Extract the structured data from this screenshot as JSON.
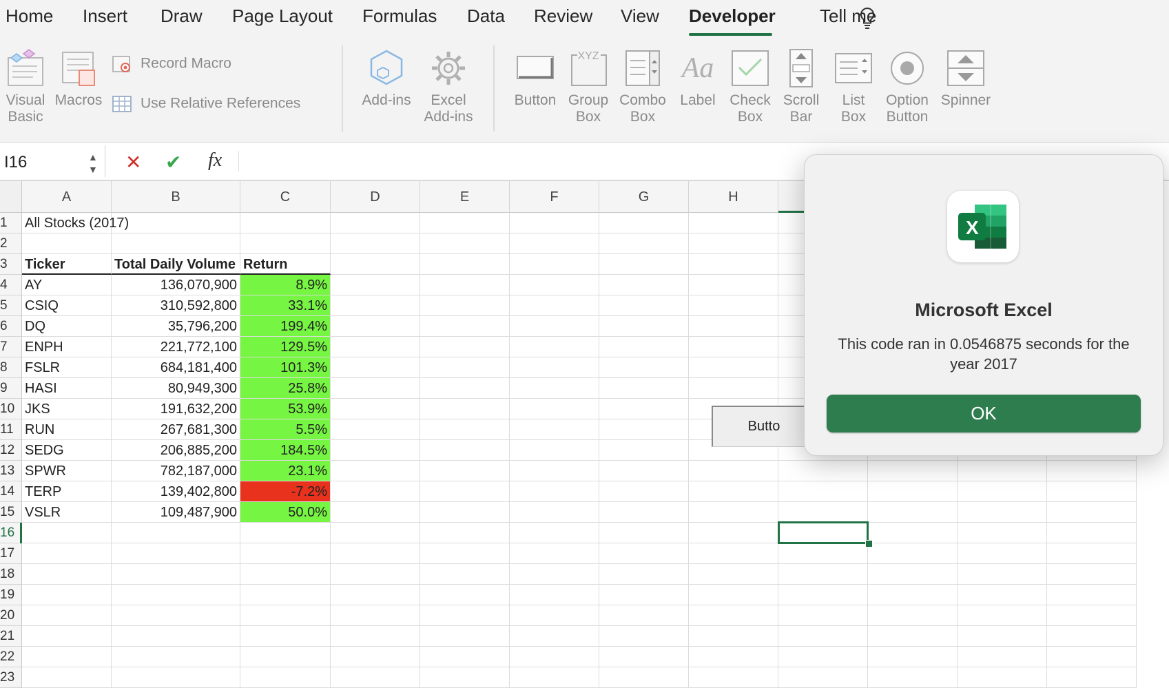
{
  "ribbon_tabs": [
    "Home",
    "Insert",
    "Draw",
    "Page Layout",
    "Formulas",
    "Data",
    "Review",
    "View",
    "Developer",
    "Tell me"
  ],
  "active_tab": "Developer",
  "ribbon": {
    "visual_basic": "Visual Basic",
    "macros": "Macros",
    "record_macro": "Record Macro",
    "use_relative": "Use Relative References",
    "add_ins": "Add-ins",
    "excel_add_ins": "Excel Add-ins",
    "button": "Button",
    "group_box": "Group Box",
    "combo_box": "Combo Box",
    "label": "Label",
    "check_box": "Check Box",
    "scroll_bar": "Scroll Bar",
    "list_box": "List Box",
    "option_button": "Option Button",
    "spinner": "Spinner"
  },
  "formula_bar": {
    "name_box": "I16",
    "fx": "fx",
    "formula": ""
  },
  "columns": [
    "A",
    "B",
    "C",
    "D",
    "E",
    "F",
    "G",
    "H"
  ],
  "rows": [
    "1",
    "2",
    "3",
    "4",
    "5",
    "6",
    "7",
    "8",
    "9",
    "10",
    "11",
    "12",
    "13",
    "14",
    "15",
    "16",
    "17",
    "18",
    "19",
    "20",
    "21",
    "22",
    "23"
  ],
  "sheet": {
    "title": "All Stocks (2017)",
    "headers": {
      "ticker": "Ticker",
      "volume": "Total Daily Volume",
      "return": "Return"
    },
    "data": [
      {
        "ticker": "AY",
        "volume": "136,070,900",
        "return": "8.9%",
        "status": "positive"
      },
      {
        "ticker": "CSIQ",
        "volume": "310,592,800",
        "return": "33.1%",
        "status": "positive"
      },
      {
        "ticker": "DQ",
        "volume": "35,796,200",
        "return": "199.4%",
        "status": "positive"
      },
      {
        "ticker": "ENPH",
        "volume": "221,772,100",
        "return": "129.5%",
        "status": "positive"
      },
      {
        "ticker": "FSLR",
        "volume": "684,181,400",
        "return": "101.3%",
        "status": "positive"
      },
      {
        "ticker": "HASI",
        "volume": "80,949,300",
        "return": "25.8%",
        "status": "positive"
      },
      {
        "ticker": "JKS",
        "volume": "191,632,200",
        "return": "53.9%",
        "status": "positive"
      },
      {
        "ticker": "RUN",
        "volume": "267,681,300",
        "return": "5.5%",
        "status": "positive"
      },
      {
        "ticker": "SEDG",
        "volume": "206,885,200",
        "return": "184.5%",
        "status": "positive"
      },
      {
        "ticker": "SPWR",
        "volume": "782,187,000",
        "return": "23.1%",
        "status": "positive"
      },
      {
        "ticker": "TERP",
        "volume": "139,402,800",
        "return": "-7.2%",
        "status": "negative"
      },
      {
        "ticker": "VSLR",
        "volume": "109,487,900",
        "return": "50.0%",
        "status": "positive"
      }
    ],
    "sheet_button_label": "Butto",
    "selected_row": "16"
  },
  "dialog": {
    "title": "Microsoft Excel",
    "message": "This code ran in 0.0546875 seconds for the year 2017",
    "ok_label": "OK",
    "app_icon_letter": "X"
  },
  "colors": {
    "accent": "#217346",
    "positive_fill": "#76f542",
    "negative_fill": "#e8321e",
    "ok_button": "#2e7d4f"
  }
}
